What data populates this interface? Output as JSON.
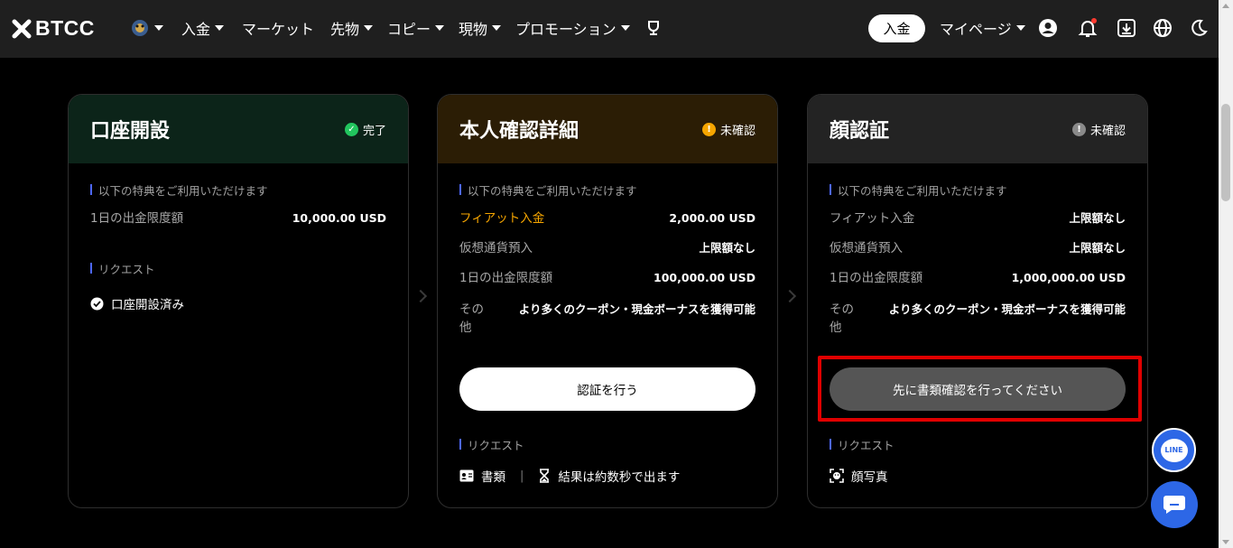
{
  "nav": {
    "brand": "BTCC",
    "menu": [
      {
        "label": "入金",
        "has_caret": true
      },
      {
        "label": "マーケット",
        "has_caret": false
      },
      {
        "label": "先物",
        "has_caret": true
      },
      {
        "label": "コピー",
        "has_caret": true
      },
      {
        "label": "現物",
        "has_caret": true
      },
      {
        "label": "プロモーション",
        "has_caret": true
      }
    ],
    "deposit_button": "入金",
    "mypage": "マイページ",
    "icons": [
      "user-circle-icon",
      "bell-icon",
      "download-icon",
      "globe-icon",
      "moon-icon"
    ]
  },
  "cards": [
    {
      "title": "口座開設",
      "status": "完了",
      "status_color": "#22c55e",
      "header_color": "#0c2419",
      "benefits_label": "以下の特典をご利用いただけます",
      "rows": [
        {
          "key": "1日の出金限度額",
          "value": "10,000.00 USD"
        }
      ],
      "request_label": "リクエスト",
      "request_items": [
        "口座開設済み"
      ]
    },
    {
      "title": "本人確認詳細",
      "status": "未確認",
      "status_color": "#f7a600",
      "header_color": "#2b1d05",
      "benefits_label": "以下の特典をご利用いただけます",
      "rows": [
        {
          "key": "フィアット入金",
          "value": "2,000.00 USD"
        },
        {
          "key": "仮想通貨預入",
          "value": "上限額なし"
        },
        {
          "key": "1日の出金限度額",
          "value": "100,000.00 USD"
        },
        {
          "key": "その他",
          "value": "より多くのクーポン・現金ボーナスを獲得可能"
        }
      ],
      "button": "認証を行う",
      "request_label": "リクエスト",
      "request_items": [
        "書類",
        "結果は約数秒で出ます"
      ]
    },
    {
      "title": "顔認証",
      "status": "未確認",
      "status_color": "#8a8a8a",
      "header_color": "#232323",
      "benefits_label": "以下の特典をご利用いただけます",
      "rows": [
        {
          "key": "フィアット入金",
          "value": "上限額なし"
        },
        {
          "key": "仮想通貨預入",
          "value": "上限額なし"
        },
        {
          "key": "1日の出金限度額",
          "value": "1,000,000.00 USD"
        },
        {
          "key": "その他",
          "value": "より多くのクーポン・現金ボーナスを獲得可能"
        }
      ],
      "button": "先に書類確認を行ってください",
      "request_label": "リクエスト",
      "request_items": [
        "顔写真"
      ]
    }
  ],
  "floating": {
    "line_label": "LINE"
  },
  "colors": {
    "accent_blue": "#4d67ff",
    "highlight_orange": "#f7a600",
    "annotation_red": "#e00000"
  }
}
